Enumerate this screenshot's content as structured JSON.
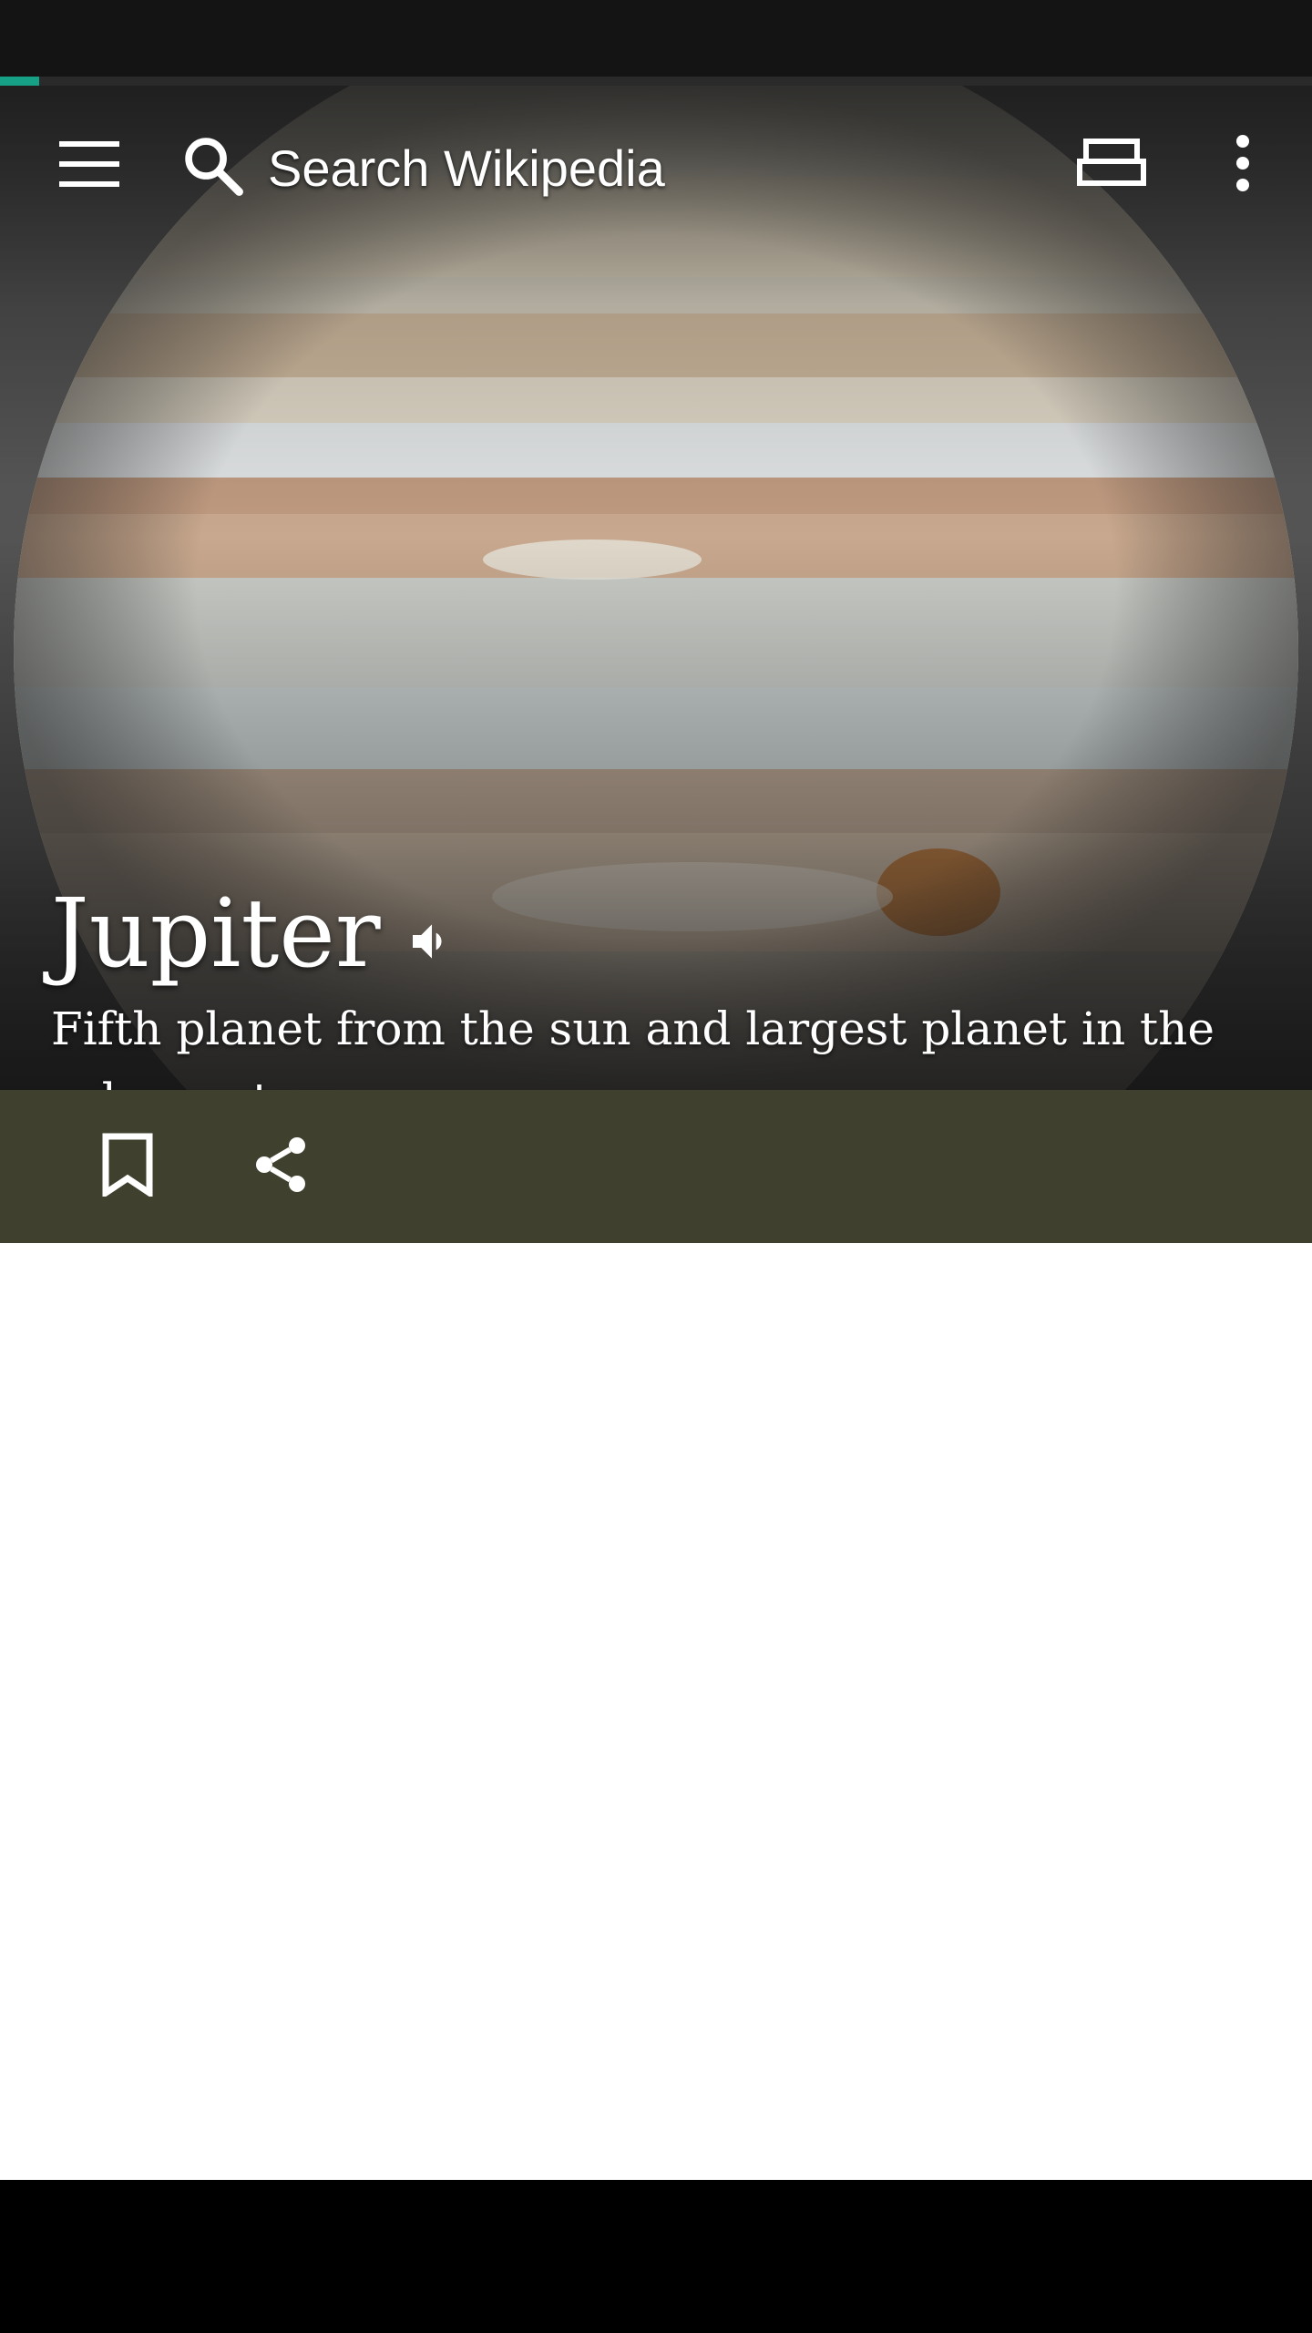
{
  "progress": 0.03,
  "colors": {
    "accent": "#16a085",
    "action_bar": "#40402f",
    "status_bar": "#141414"
  },
  "toolbar": {
    "menu_icon": "hamburger-menu-icon",
    "search_icon": "search-icon",
    "search_placeholder": "Search Wikipedia",
    "tabs_icon": "tabs-icon",
    "more_icon": "more-vert-icon"
  },
  "article": {
    "title": "Jupiter",
    "audio_icon": "speaker-icon",
    "description": "Fifth planet from the sun and largest planet in the solar system"
  },
  "actions": {
    "bookmark_icon": "bookmark-icon",
    "share_icon": "share-icon"
  }
}
